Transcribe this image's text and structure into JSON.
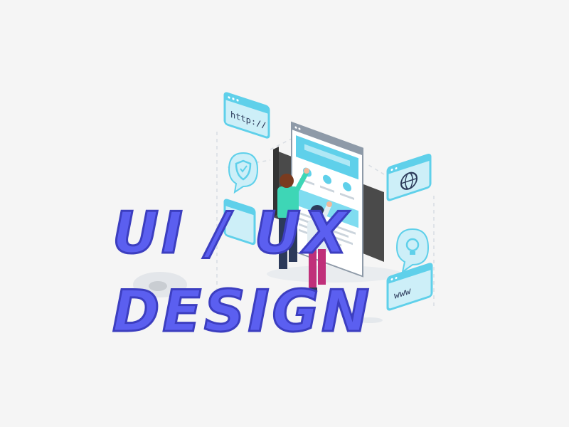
{
  "headline": {
    "line1": "UI / UX",
    "line2": "DESIGN"
  },
  "icons": {
    "http_window": "http://",
    "www_window": "www"
  },
  "colors": {
    "background": "#f5f5f5",
    "headline_fill": "#5b5ff0",
    "headline_outline": "#3c3ec0",
    "accent_cyan": "#5fd0ea",
    "light_cyan": "#cdeff8",
    "teal_shirt": "#3ed6b6",
    "magenta_pants": "#c0307a",
    "navy": "#2c3a5a",
    "screen_frame": "#4a4a4a"
  }
}
